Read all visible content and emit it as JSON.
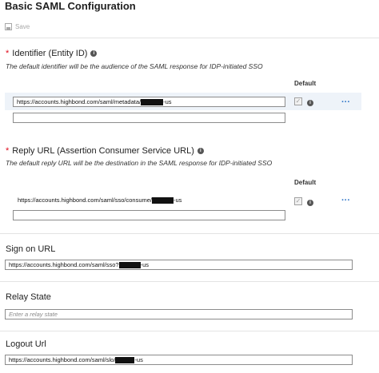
{
  "title": "Basic SAML Configuration",
  "toolbar": {
    "save_label": "Save"
  },
  "identifier": {
    "label": "Identifier (Entity ID)",
    "description": "The default identifier will be the audience of the SAML response for IDP-initiated SSO",
    "default_header": "Default",
    "value_prefix": "https://accounts.highbond.com/saml/metadata/",
    "value_suffix": "-us"
  },
  "reply_url": {
    "label": "Reply URL (Assertion Consumer Service URL)",
    "description": "The default reply URL will be the destination in the SAML response for IDP-initiated SSO",
    "default_header": "Default",
    "value_prefix": "https://accounts.highbond.com/saml/sso/consume/",
    "value_suffix": "-us"
  },
  "sign_on": {
    "label": "Sign on URL",
    "value_prefix": "https://accounts.highbond.com/saml/sso?",
    "value_suffix": "-us"
  },
  "relay_state": {
    "label": "Relay State",
    "placeholder": "Enter a relay state"
  },
  "logout": {
    "label": "Logout Url",
    "value_prefix": "https://accounts.highbond.com/saml/slo/",
    "value_suffix": "-us"
  },
  "icons": {
    "required": "*",
    "info": "i",
    "check": "✓",
    "more": "···"
  }
}
